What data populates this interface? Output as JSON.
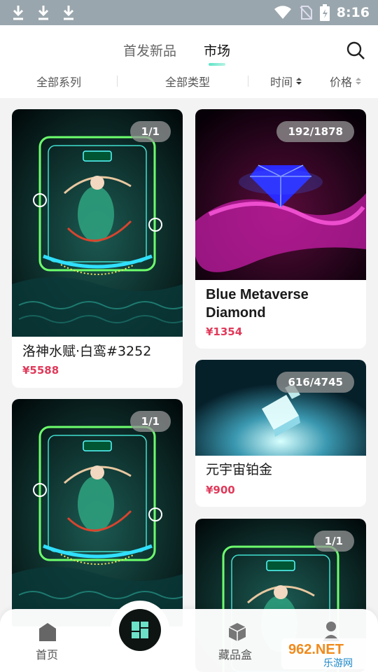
{
  "status_bar": {
    "time": "8:16"
  },
  "header": {
    "tabs": [
      {
        "label": "首发新品"
      },
      {
        "label": "市场"
      }
    ],
    "filters": [
      {
        "label": "全部系列"
      },
      {
        "label": "全部类型"
      },
      {
        "label": "时间"
      },
      {
        "label": "价格"
      }
    ]
  },
  "cards": [
    {
      "badge": "1/1",
      "title": "洛神水赋·白鸾#3252",
      "price": "¥5588"
    },
    {
      "badge": "192/1878",
      "title_line1": "Blue Metaverse",
      "title_line2": "Diamond",
      "price": "¥1354"
    },
    {
      "badge": "1/1",
      "title": "",
      "price": ""
    },
    {
      "badge": "616/4745",
      "title": "元宇宙铂金",
      "price": "¥900"
    },
    {
      "badge": "1/1",
      "title": "",
      "price": ""
    }
  ],
  "bottom_nav": {
    "home_label": "首页",
    "collection_label": "藏品盒"
  },
  "watermark": {
    "text_top": "962.NET",
    "text_bottom": "乐游网"
  },
  "colors": {
    "price": "#e03a5a",
    "accent": "#5fe3c8",
    "status_bar": "#9aa6ad"
  },
  "icons": [
    "download-icon",
    "wifi-icon",
    "no-sim-icon",
    "battery-icon",
    "search-icon",
    "sort-icon",
    "home-icon",
    "grid-icon",
    "box-icon",
    "profile-icon"
  ]
}
